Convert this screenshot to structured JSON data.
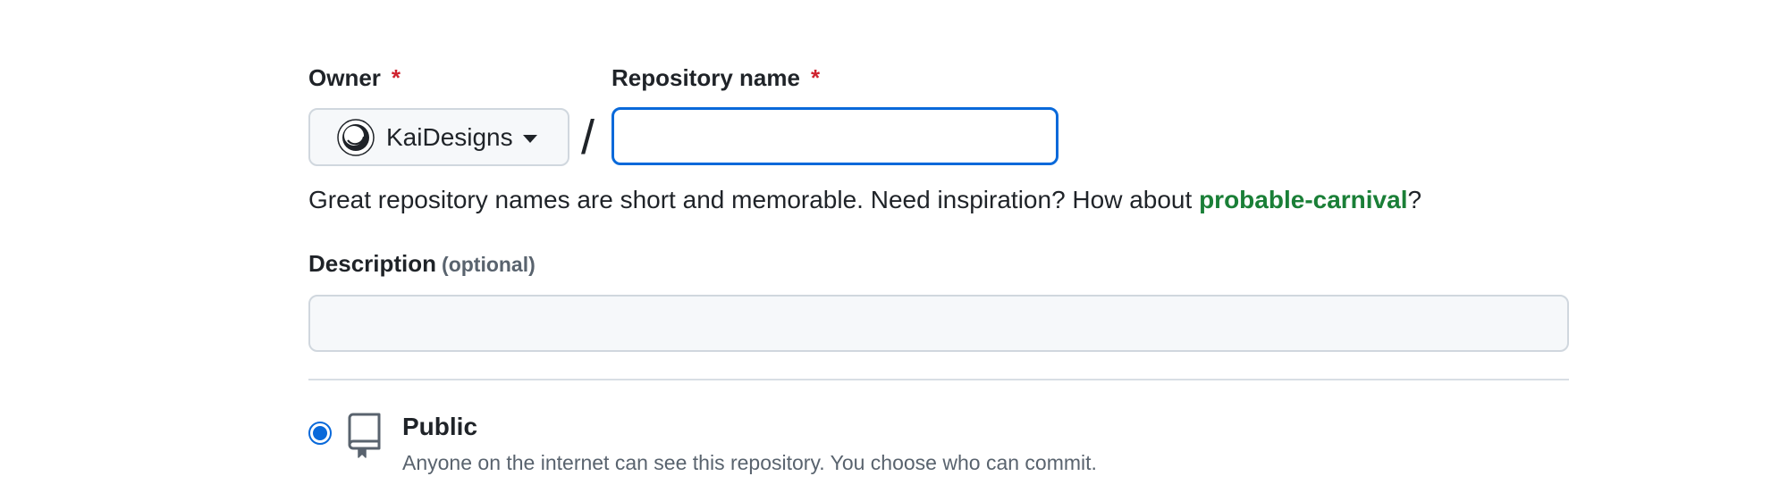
{
  "owner": {
    "label": "Owner",
    "required_mark": "*",
    "selected": "KaiDesigns"
  },
  "repository_name": {
    "label": "Repository name",
    "required_mark": "*",
    "value": ""
  },
  "separator": "/",
  "hint": {
    "text": "Great repository names are short and memorable. Need inspiration? How about ",
    "suggestion": "probable-carnival",
    "suffix": "?"
  },
  "description": {
    "label": "Description",
    "optional_note": "(optional)",
    "value": ""
  },
  "visibility": {
    "option_title": "Public",
    "option_description": "Anyone on the internet can see this repository. You choose who can commit.",
    "selected": true
  },
  "icons": {
    "avatar": "owner-avatar-icon",
    "dropdown": "caret-down-icon",
    "repo": "repo-icon"
  },
  "colors": {
    "focus_border": "#0969da",
    "required": "#cf222e",
    "suggestion_link": "#1a7f37",
    "muted_text": "#59636e"
  }
}
